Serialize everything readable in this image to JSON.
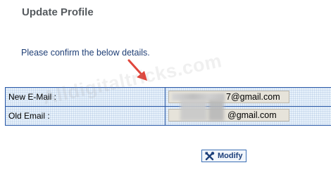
{
  "page": {
    "title": "Update Profile",
    "subtitle": "Please confirm the below details."
  },
  "details": {
    "rows": [
      {
        "label": "New E-Mail :",
        "value": "@gmail.com",
        "value_prefix_visible": "7"
      },
      {
        "label": "Old Email :",
        "value": "@gmail.com"
      }
    ]
  },
  "actions": {
    "modify_label": "Modify"
  },
  "watermark": "Alldigitaltricks.com",
  "colors": {
    "title": "#555a5e",
    "subtitle": "#1f3f76",
    "table_border": "#2c5aa8",
    "table_bg": "#e8f2fb",
    "field_bg": "#e6e3da",
    "arrow": "#e0463c"
  },
  "icons": {
    "modify": "tools-icon",
    "annotation": "red-arrow-icon"
  }
}
